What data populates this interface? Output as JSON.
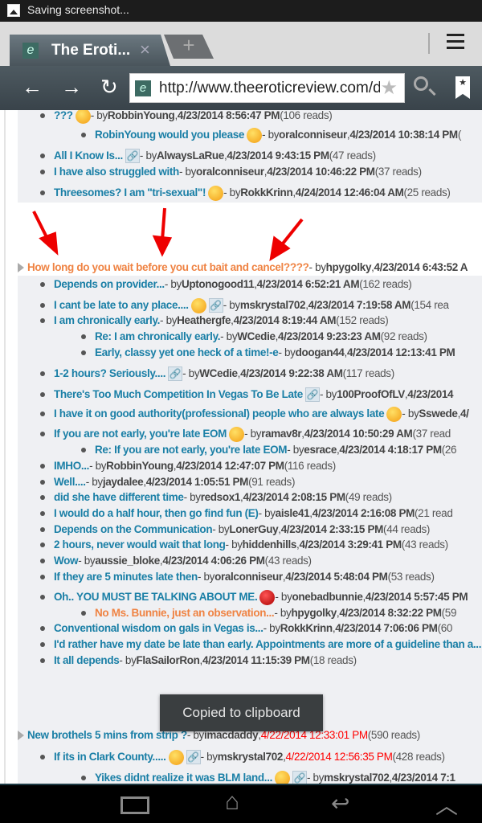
{
  "status_bar": {
    "icon": "image-icon",
    "text": "Saving screenshot..."
  },
  "browser": {
    "tab_title": "The Eroti...",
    "tab_close": "×",
    "new_tab": "+",
    "url": "http://www.theeroticreview.com/discussion-boards/",
    "back": "←",
    "forward": "→",
    "reload": "↻",
    "bookmark": "★"
  },
  "colors": {
    "link": "#1a7fa6",
    "highlight": "#ef8343",
    "new_date": "#ff0000",
    "annotation_arrow": "#ee0000"
  },
  "threads": [
    {
      "header": null,
      "replies": [
        {
          "level": 1,
          "title": "???",
          "icons": [
            "smile-icon"
          ],
          "author": "RobbinYoung",
          "date": "4/23/2014 8:56:47 PM",
          "reads": "(106 reads)"
        },
        {
          "level": 2,
          "title": "RobinYoung would you please",
          "icons": [
            "eyes-roll-icon"
          ],
          "author": "oralconniseur",
          "date": "4/23/2014 10:38:14 PM",
          "reads": "("
        },
        {
          "level": 1,
          "title": "All I Know Is...",
          "icons": [
            "link-icon"
          ],
          "author": "AlwaysLaRue",
          "date": "4/23/2014 9:43:15 PM",
          "reads": "(47 reads)"
        },
        {
          "level": 1,
          "title": "I have also struggled with",
          "icons": [],
          "author": "oralconniseur",
          "date": "4/23/2014 10:46:22 PM",
          "reads": "(37 reads)"
        },
        {
          "level": 1,
          "title": "Threesomes? I am \"tri-sexual\"!",
          "icons": [
            "laugh-icon"
          ],
          "author": "RokkKrinn",
          "date": "4/24/2014 12:46:04 AM",
          "reads": "(25 reads)"
        }
      ]
    },
    {
      "header": {
        "title": "How long do you wait before you cut bait and cancel????",
        "author": "hpygolky",
        "date": "4/23/2014 6:43:52 A",
        "reads": "",
        "highlight": true
      },
      "replies": [
        {
          "level": 1,
          "title": "Depends on provider...",
          "icons": [],
          "author": "Uptonogood11",
          "date": "4/23/2014 6:52:21 AM",
          "reads": "(162 reads)"
        },
        {
          "level": 1,
          "title": "I cant be late to any place....",
          "icons": [
            "laugh-icon",
            "link-icon"
          ],
          "author": "mskrystal702",
          "date": "4/23/2014 7:19:58 AM",
          "reads": "(154 rea"
        },
        {
          "level": 1,
          "title": "I am chronically early.",
          "icons": [],
          "author": "Heathergfe",
          "date": "4/23/2014 8:19:44 AM",
          "reads": "(152 reads)"
        },
        {
          "level": 2,
          "title": "Re: I am chronically early.",
          "icons": [],
          "author": "WCedie",
          "date": "4/23/2014 9:23:23 AM",
          "reads": "(92 reads)"
        },
        {
          "level": 2,
          "title": "Early, classy yet one heck of a time!-e",
          "icons": [],
          "author": "doogan44",
          "date": "4/23/2014 12:13:41 PM",
          "reads": ""
        },
        {
          "level": 1,
          "title": "1-2 hours? Seriously....",
          "icons": [
            "link-icon"
          ],
          "author": "WCedie",
          "date": "4/23/2014 9:22:38 AM",
          "reads": "(117 reads)"
        },
        {
          "level": 1,
          "title": "There's Too Much Competition In Vegas To Be Late",
          "icons": [
            "link-icon"
          ],
          "author": "100ProofOfLV",
          "date": "4/23/2014",
          "reads": ""
        },
        {
          "level": 1,
          "title": "I have it on good authority(professional) people who are always late",
          "icons": [
            "eyes-roll-icon"
          ],
          "author": "Sswede",
          "date": "4/",
          "reads": ""
        },
        {
          "level": 1,
          "title": "If you are not early, you're late EOM",
          "icons": [
            "laugh-icon"
          ],
          "author": "ramav8r",
          "date": "4/23/2014 10:50:29 AM",
          "reads": "(37 read"
        },
        {
          "level": 2,
          "title": "Re: If you are not early, you're late EOM",
          "icons": [],
          "author": "esrace",
          "date": "4/23/2014 4:18:17 PM",
          "reads": "(26"
        },
        {
          "level": 1,
          "title": "IMHO...",
          "icons": [],
          "author": "RobbinYoung",
          "date": "4/23/2014 12:47:07 PM",
          "reads": "(116 reads)"
        },
        {
          "level": 1,
          "title": "Well....",
          "icons": [],
          "author": "jaydalee",
          "date": "4/23/2014 1:05:51 PM",
          "reads": "(91 reads)"
        },
        {
          "level": 1,
          "title": "did she have different time",
          "icons": [],
          "author": "redsox1",
          "date": "4/23/2014 2:08:15 PM",
          "reads": "(49 reads)"
        },
        {
          "level": 1,
          "title": "I would do a half hour, then go find fun (E)",
          "icons": [],
          "author": "aisle41",
          "date": "4/23/2014 2:16:08 PM",
          "reads": "(21 read"
        },
        {
          "level": 1,
          "title": "Depends on the Communication",
          "icons": [],
          "author": "LonerGuy",
          "date": "4/23/2014 2:33:15 PM",
          "reads": "(44 reads)"
        },
        {
          "level": 1,
          "title": "2 hours, never would wait that long",
          "icons": [],
          "author": "hiddenhills",
          "date": "4/23/2014 3:29:41 PM",
          "reads": "(43 reads)"
        },
        {
          "level": 1,
          "title": "Wow",
          "icons": [],
          "author": "aussie_bloke",
          "date": "4/23/2014 4:06:26 PM",
          "reads": "(43 reads)"
        },
        {
          "level": 1,
          "title": "If they are 5 minutes late then",
          "icons": [],
          "author": "oralconniseur",
          "date": "4/23/2014 5:48:04 PM",
          "reads": "(53 reads)"
        },
        {
          "level": 1,
          "title": "Oh.. YOU MUST BE TALKING ABOUT ME.",
          "icons": [
            "devil-icon"
          ],
          "author": "onebadbunnie",
          "date": "4/23/2014 5:57:45 PM",
          "reads": ""
        },
        {
          "level": 2,
          "title": "No Ms. Bunnie, just an observation...",
          "highlight": true,
          "icons": [],
          "author": "hpygolky",
          "date": "4/23/2014 8:32:22 PM",
          "reads": "(59"
        },
        {
          "level": 1,
          "title": "Conventional wisdom on gals in Vegas is...",
          "icons": [],
          "author": "RokkKrinn",
          "date": "4/23/2014 7:06:06 PM",
          "reads": "(60"
        },
        {
          "level": 1,
          "title": "I'd rather have my date be late than early. Appointments are more of a guideline than a...",
          "icons": [],
          "author": "",
          "date": "",
          "reads": ""
        },
        {
          "level": 1,
          "title": "It all depends",
          "icons": [],
          "author": "FlaSailorRon",
          "date": "4/23/2014 11:15:39 PM",
          "reads": "(18 reads)"
        }
      ]
    },
    {
      "header": {
        "title": "New brothels 5 mins from strip ?",
        "author": "imacdaddy",
        "date": "4/22/2014 12:33:01 PM",
        "date_new": true,
        "reads": "(590 reads)"
      },
      "replies": [
        {
          "level": 1,
          "title": "If its in Clark County.....",
          "icons": [
            "eyes-roll-icon",
            "link-icon"
          ],
          "author": "mskrystal702",
          "date": "4/22/2014 12:56:35 PM",
          "date_new": true,
          "reads": "(428 reads)"
        },
        {
          "level": 2,
          "title": "Yikes didnt realize it was BLM land...",
          "icons": [
            "worried-icon",
            "link-icon"
          ],
          "author": "mskrystal702",
          "date": "4/23/2014 7:1",
          "reads": ""
        }
      ]
    }
  ],
  "by_label": " - by ",
  "toast": "Copied to clipboard",
  "nav_bar": {
    "recent": "recent-apps-icon",
    "home": "home-icon",
    "back": "back-icon",
    "up": "chevron-up-icon"
  }
}
